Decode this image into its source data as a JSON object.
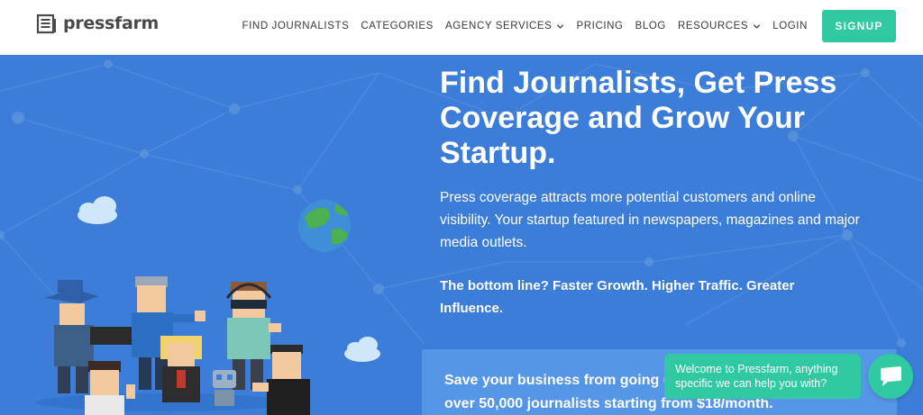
{
  "brand": {
    "name": "pressfarm"
  },
  "nav": {
    "items": [
      {
        "label": "FIND JOURNALISTS"
      },
      {
        "label": "CATEGORIES"
      },
      {
        "label": "AGENCY SERVICES"
      },
      {
        "label": "PRICING"
      },
      {
        "label": "BLOG"
      },
      {
        "label": "RESOURCES"
      },
      {
        "label": "LOGIN"
      }
    ],
    "signup_label": "SIGNUP"
  },
  "hero": {
    "headline": "Find Journalists, Get Press Coverage and Grow Your Startup.",
    "paragraph": "Press coverage attracts more potential customers and online visibility. Your startup featured in newspapers, magazines and major media outlets.",
    "bottom_line": "The bottom line? Faster Growth. Higher Traffic. Greater Influence.",
    "cta_line1": "Save your business from going unnoticed. Get access to",
    "cta_line2": "over 50,000 journalists starting from $18/month."
  },
  "chat": {
    "message": "Welcome to Pressfarm, anything specific we can help you with?",
    "icon": "chat-icon"
  },
  "colors": {
    "hero_bg": "#3b7dd8",
    "accent": "#30c9a2",
    "cta_box": "#5596e6"
  }
}
